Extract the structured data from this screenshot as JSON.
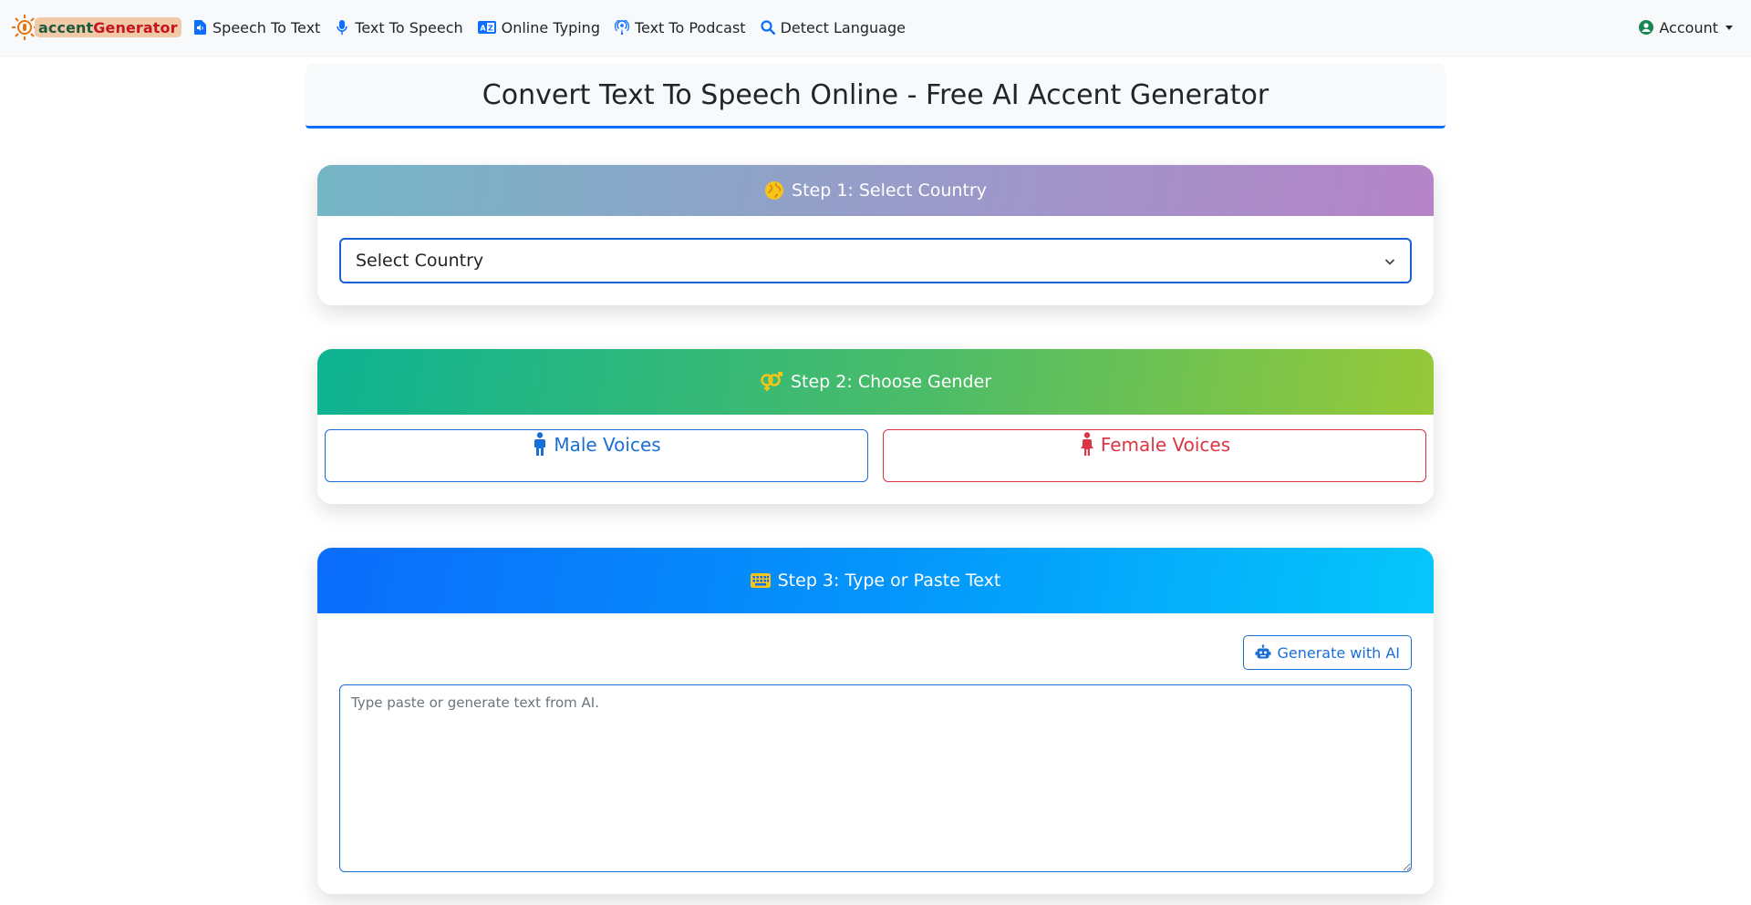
{
  "navbar": {
    "logo": {
      "part1": "accent",
      "part2": "Generator"
    },
    "items": [
      {
        "label": "Speech To Text",
        "icon": "file-audio-icon"
      },
      {
        "label": "Text To Speech",
        "icon": "microphone-icon"
      },
      {
        "label": "Online Typing",
        "icon": "translate-icon"
      },
      {
        "label": "Text To Podcast",
        "icon": "podcast-icon"
      },
      {
        "label": "Detect Language",
        "icon": "search-icon"
      }
    ],
    "account": {
      "label": "Account",
      "icon": "user-circle-icon"
    }
  },
  "page_title": "Convert Text To Speech Online - Free AI Accent Generator",
  "step1": {
    "title": "Step 1: Select Country",
    "icon": "globe-icon",
    "select_value": "Select Country"
  },
  "step2": {
    "title": "Step 2: Choose Gender",
    "icon": "gender-icon",
    "male_label": "Male Voices",
    "female_label": "Female Voices"
  },
  "step3": {
    "title": "Step 3: Type or Paste Text",
    "icon": "keyboard-icon",
    "ai_button_label": "Generate with AI",
    "textarea_placeholder": "Type paste or generate text from AI.",
    "textarea_value": ""
  },
  "colors": {
    "primary": "#0d6efd",
    "male": "#1a6fd6",
    "female": "#dc3545",
    "icon_yellow": "#f5c518"
  }
}
